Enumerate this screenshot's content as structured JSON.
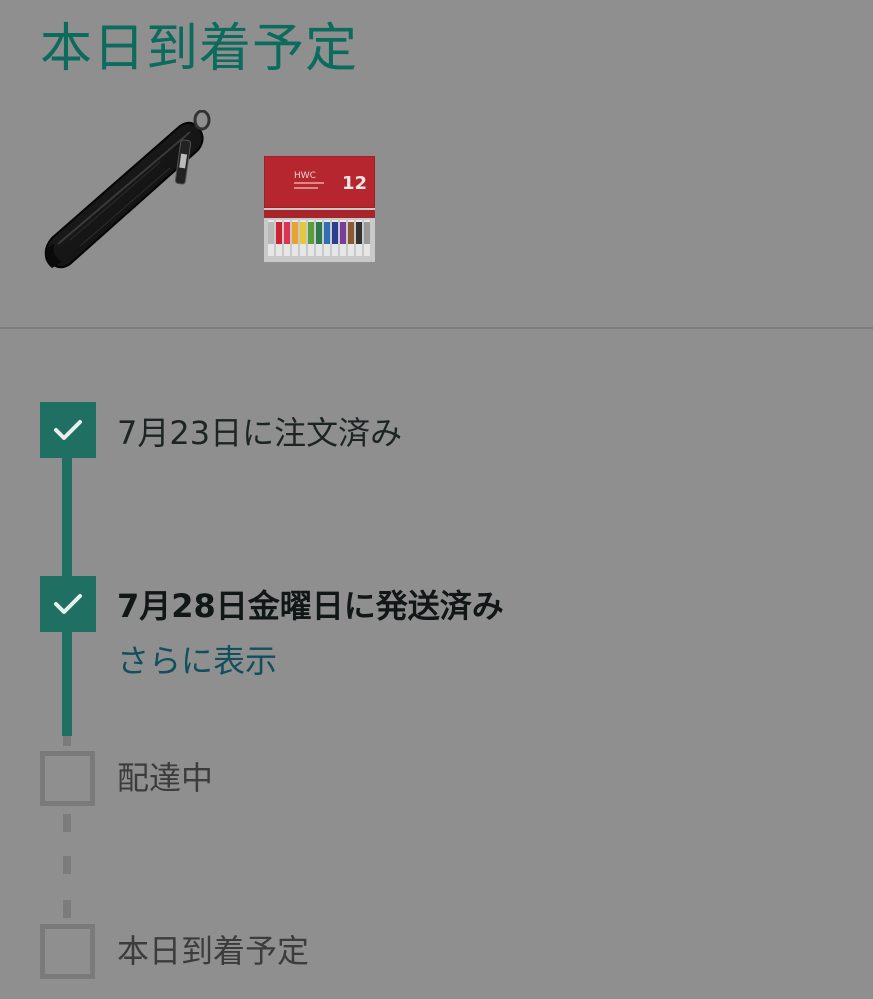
{
  "header": {
    "title": "本日到着予定"
  },
  "products": [
    {
      "name": "pencil-case-image"
    },
    {
      "name": "watercolor-paint-set-image",
      "badge_text": "12",
      "brand_text": "HWC"
    }
  ],
  "tracking": {
    "steps": [
      {
        "label": "7月23日に注文済み",
        "status": "done"
      },
      {
        "label": "7月28日金曜日に発送済み",
        "status": "done"
      },
      {
        "label": "配達中",
        "status": "pending"
      },
      {
        "label": "本日到着予定",
        "status": "pending"
      }
    ],
    "more_link": "さらに表示"
  },
  "colors": {
    "accent": "#1f6f63",
    "title": "#0b6b5c",
    "link": "#104f5c",
    "background": "#8f8f8f"
  }
}
